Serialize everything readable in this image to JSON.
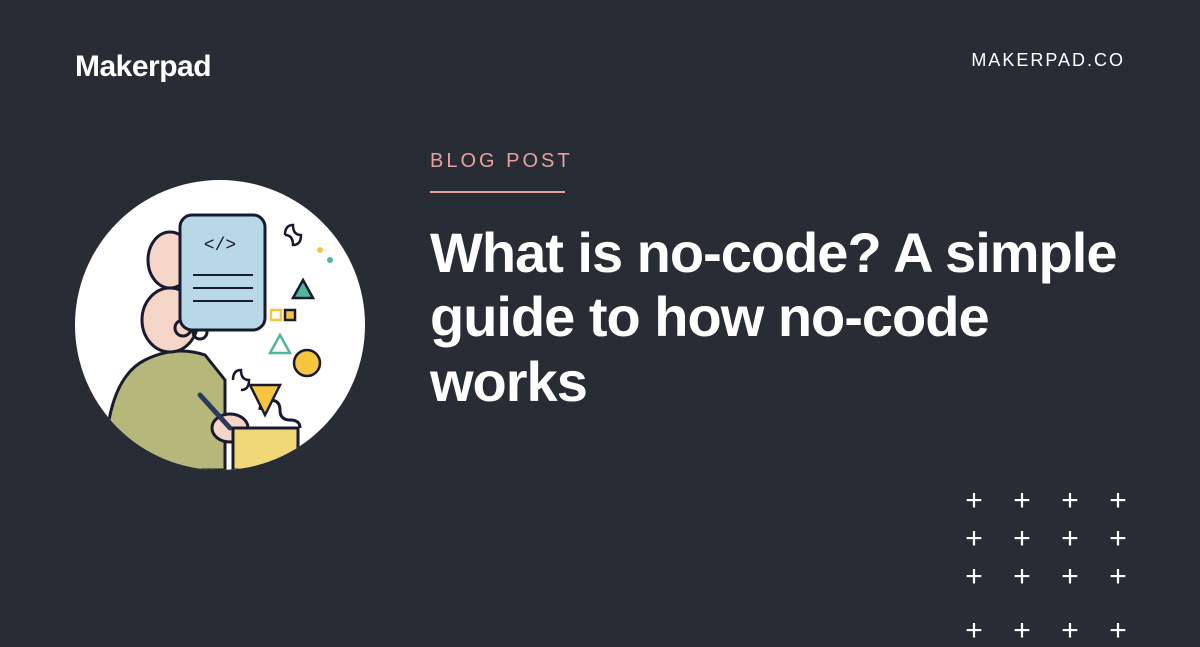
{
  "header": {
    "logo": "Makerpad",
    "domain": "MAKERPAD.CO"
  },
  "content": {
    "category": "BLOG POST",
    "title": "What is no-code? A simple guide to how no-code works"
  },
  "decor": {
    "plus": "+"
  }
}
